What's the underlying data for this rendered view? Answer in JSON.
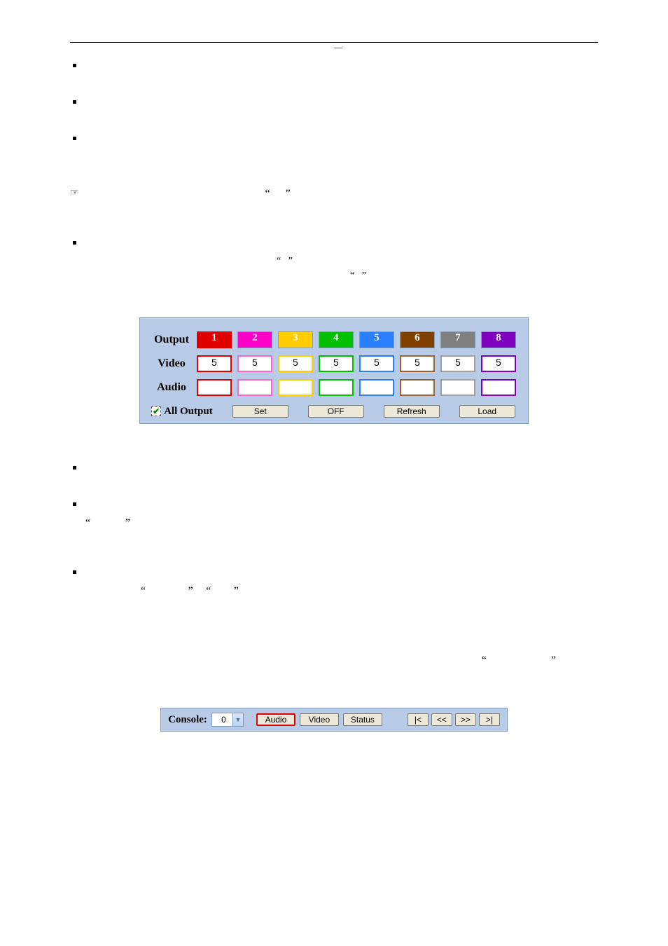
{
  "header": {
    "dash": "—"
  },
  "bullets1": {
    "it0_link": " ",
    "it1_link": " ",
    "it3_link": " ",
    "q_open": "“",
    "q_close": "”"
  },
  "map": {
    "output_label": "Output",
    "video_label": "Video",
    "audio_label": "Audio",
    "cols": [
      "1",
      "2",
      "3",
      "4",
      "5",
      "6",
      "7",
      "8"
    ],
    "video_vals": [
      "5",
      "5",
      "5",
      "5",
      "5",
      "5",
      "5",
      "5"
    ],
    "all_output": "All Output",
    "btn_set": "Set",
    "btn_off": "OFF",
    "btn_refresh": "Refresh",
    "btn_load": "Load"
  },
  "bullets2": {
    "q_open": "“",
    "q_close": "”"
  },
  "console": {
    "label": "Console:",
    "dd_value": "0",
    "btn_audio": "Audio",
    "btn_video": "Video",
    "btn_status": "Status",
    "nav_first": "|<",
    "nav_prev": "<<",
    "nav_next": ">>",
    "nav_last": ">|"
  }
}
